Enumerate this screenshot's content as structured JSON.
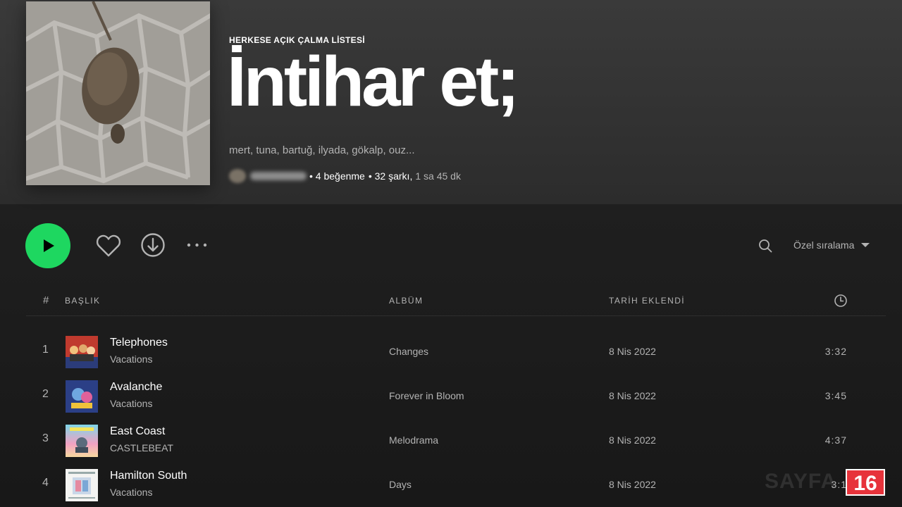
{
  "playlist": {
    "type_label": "HERKESE AÇIK ÇALMA LİSTESİ",
    "title": "İntihar et;",
    "description": "mert, tuna, bartuğ, ilyada, gökalp, ouz...",
    "likes": "• 4 beğenme",
    "songs": "• 32 şarkı,",
    "duration": "1 sa 45 dk"
  },
  "actions": {
    "sort_label": "Özel sıralama"
  },
  "table": {
    "headers": {
      "num": "#",
      "title": "BAŞLIK",
      "album": "ALBÜM",
      "date_added": "TARİH EKLENDİ"
    },
    "rows": [
      {
        "num": "1",
        "title": "Telephones",
        "artist": "Vacations",
        "album": "Changes",
        "date": "8 Nis 2022",
        "duration": "3:32"
      },
      {
        "num": "2",
        "title": "Avalanche",
        "artist": "Vacations",
        "album": "Forever in Bloom",
        "date": "8 Nis 2022",
        "duration": "3:45"
      },
      {
        "num": "3",
        "title": "East Coast",
        "artist": "CASTLEBEAT",
        "album": "Melodrama",
        "date": "8 Nis 2022",
        "duration": "4:37"
      },
      {
        "num": "4",
        "title": "Hamilton South",
        "artist": "Vacations",
        "album": "Days",
        "date": "8 Nis 2022",
        "duration": "3:1"
      }
    ]
  },
  "watermark": {
    "text": "SAYFA",
    "badge": "16"
  },
  "colors": {
    "accent": "#1ed760",
    "text_secondary": "#b3b3b3",
    "badge_red": "#e7333b"
  },
  "icons": [
    "play-icon",
    "heart-icon",
    "download-icon",
    "more-icon",
    "search-icon",
    "clock-icon",
    "caret-down-icon"
  ]
}
